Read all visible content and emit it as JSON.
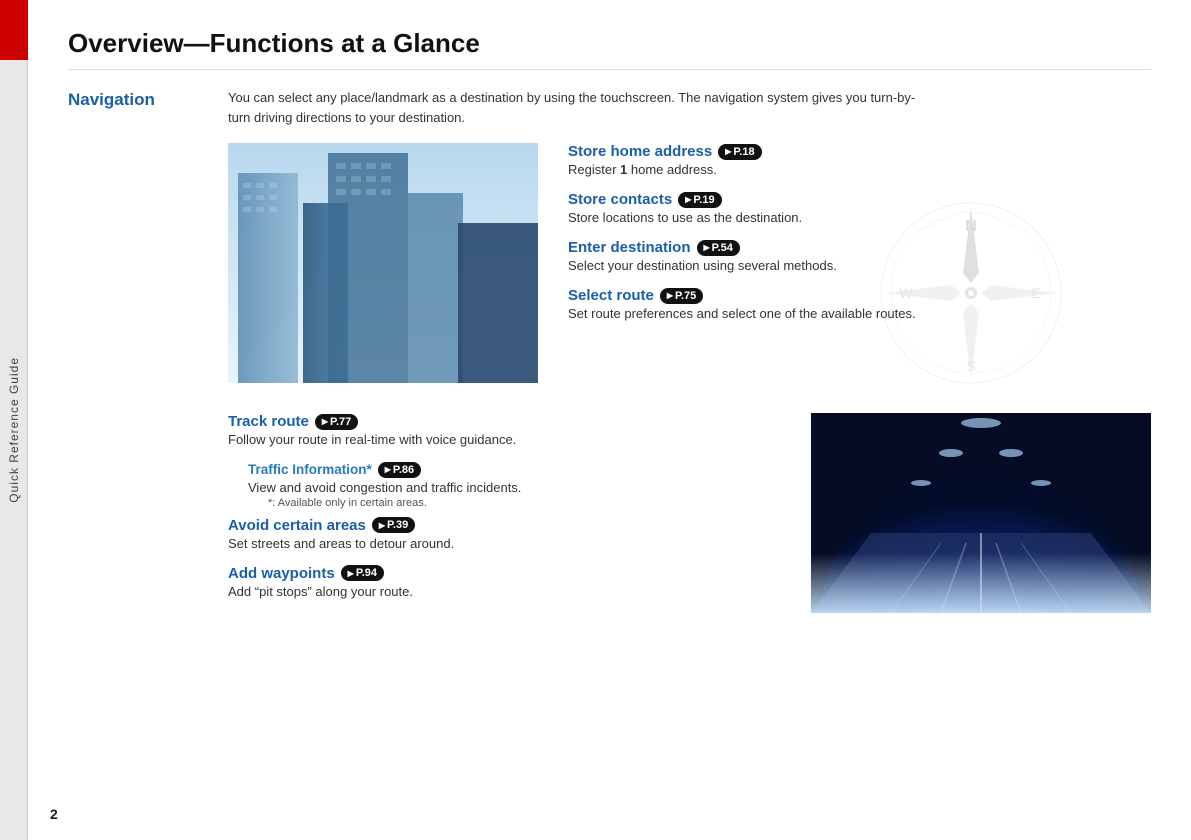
{
  "sidebar": {
    "label": "Quick Reference Guide"
  },
  "page": {
    "title": "Overview—Functions at a Glance",
    "number": "2"
  },
  "navigation": {
    "section_label": "Navigation",
    "description": "You can select any place/landmark as a destination by using the touchscreen. The navigation system gives you turn-by-turn driving directions to your destination.",
    "features": [
      {
        "title": "Store home address",
        "badge": "P.18",
        "description": "Register 1 home address."
      },
      {
        "title": "Store contacts",
        "badge": "P.19",
        "description": "Store locations to use as the destination."
      },
      {
        "title": "Enter destination",
        "badge": "P.54",
        "description": "Select your destination using several methods."
      },
      {
        "title": "Select route",
        "badge": "P.75",
        "description": "Set route preferences and select one of the available routes."
      }
    ],
    "bottom_features": [
      {
        "title": "Track route",
        "badge": "P.77",
        "description": "Follow your route in real-time with voice guidance.",
        "indent": false,
        "sub_items": [
          {
            "title": "Traffic Information*",
            "badge": "P.86",
            "description": "View and avoid congestion and traffic incidents.",
            "note": "*: Available only in certain areas."
          }
        ]
      },
      {
        "title": "Avoid certain areas",
        "badge": "P.39",
        "description": "Set streets and areas to detour around.",
        "indent": false
      },
      {
        "title": "Add waypoints",
        "badge": "P.94",
        "description": "Add “pit stops” along your route.",
        "indent": false
      }
    ]
  }
}
